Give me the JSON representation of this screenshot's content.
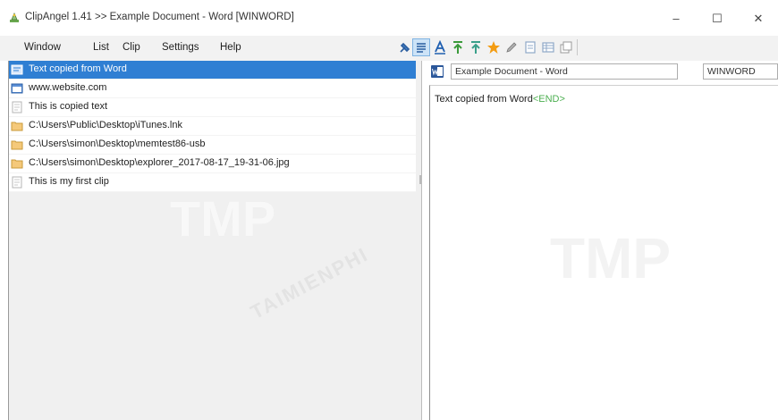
{
  "window": {
    "title": "ClipAngel 1.41 >> Example Document - Word [WINWORD]",
    "minimize_glyph": "–",
    "maximize_glyph": "☐",
    "close_glyph": "✕"
  },
  "menu": {
    "items": [
      "Window",
      "List",
      "Clip",
      "Settings",
      "Help"
    ]
  },
  "toolbar": {
    "icons": [
      "pin-icon",
      "wrap-text-icon",
      "text-format-icon",
      "move-top-icon",
      "move-up-icon",
      "favorite-star-icon",
      "edit-pencil-icon",
      "clip-preview-icon",
      "table-icon",
      "copy-icon"
    ]
  },
  "clips": [
    {
      "text": "Text copied from Word",
      "icon": "word-clip-icon",
      "selected": true
    },
    {
      "text": "www.website.com",
      "icon": "url-clip-icon",
      "selected": false
    },
    {
      "text": "This is copied text",
      "icon": "text-clip-icon",
      "selected": false
    },
    {
      "text": "C:\\Users\\Public\\Desktop\\iTunes.lnk",
      "icon": "file-clip-icon",
      "selected": false
    },
    {
      "text": "C:\\Users\\simon\\Desktop\\memtest86-usb",
      "icon": "file-clip-icon",
      "selected": false
    },
    {
      "text": "C:\\Users\\simon\\Desktop\\explorer_2017-08-17_19-31-06.jpg",
      "icon": "file-clip-icon",
      "selected": false
    },
    {
      "text": "This is my first clip",
      "icon": "text-clip-icon",
      "selected": false
    }
  ],
  "preview": {
    "window_title": "Example Document - Word",
    "process_name": "WINWORD",
    "content": "Text copied from Word",
    "end_marker": "<END>"
  },
  "watermark": {
    "left": "TMP",
    "right": "TMP",
    "diagonal": "TAIMIENPHI"
  },
  "colors": {
    "selection": "#2f7fd3",
    "end_marker": "#4caf50"
  }
}
